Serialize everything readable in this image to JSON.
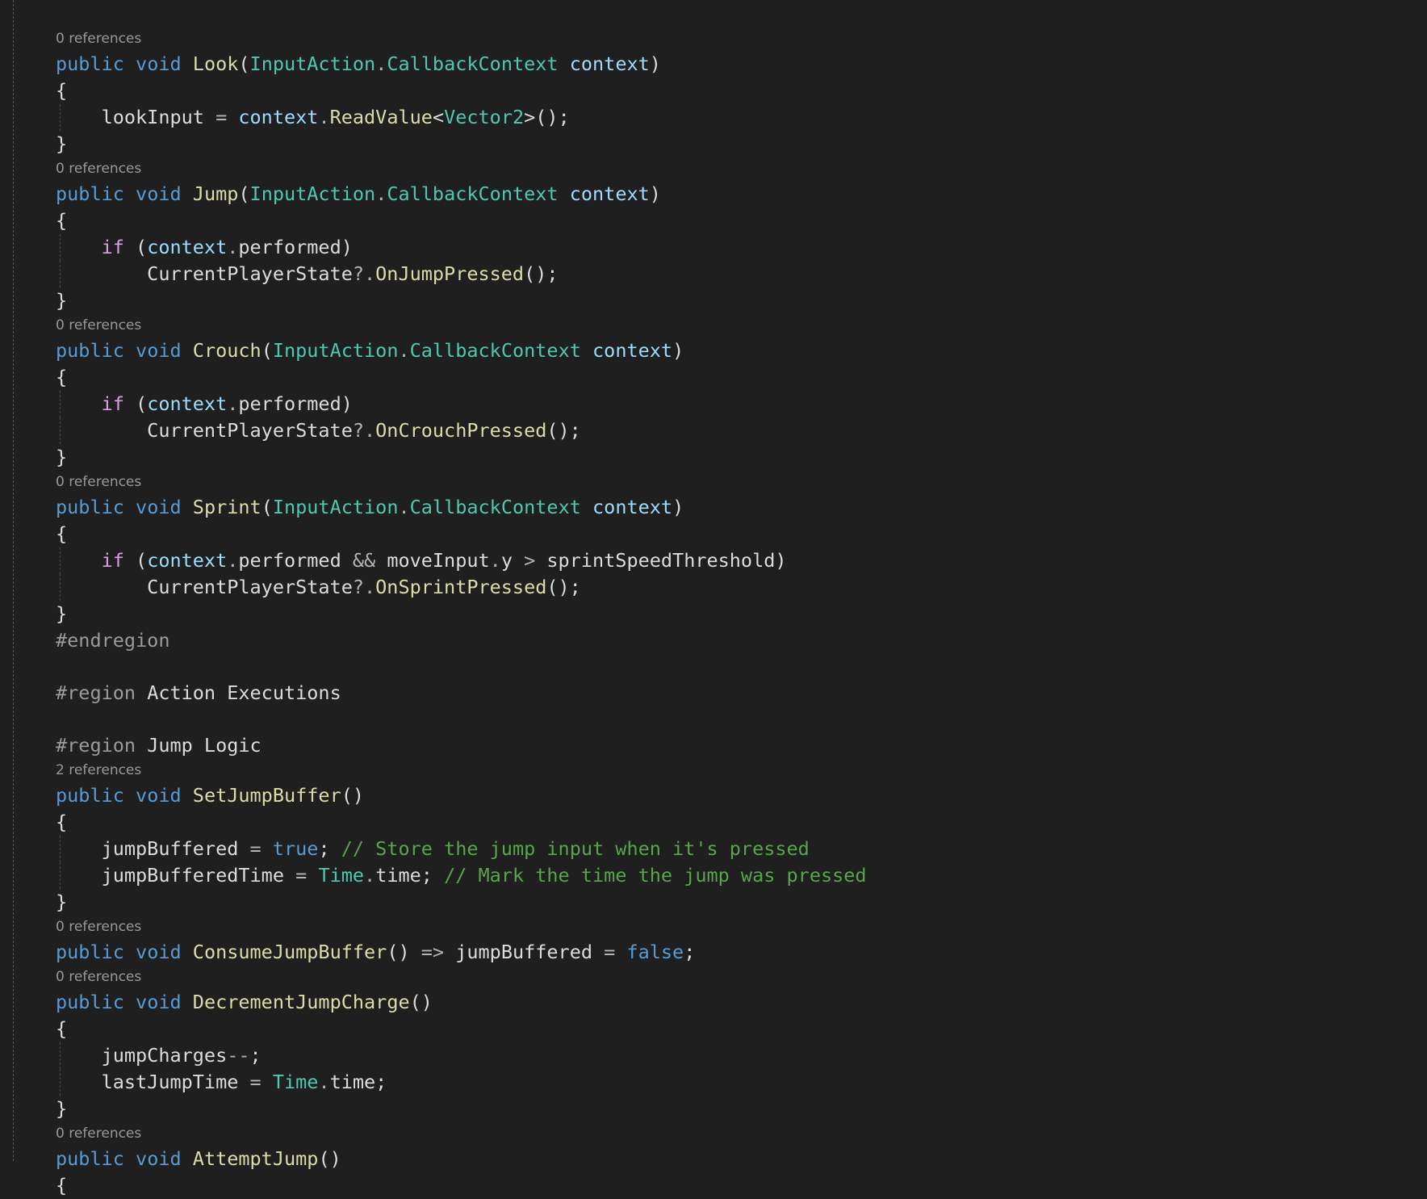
{
  "editor": {
    "colors": {
      "background": "#1f1f1f",
      "keyword": "#569cd6",
      "type": "#4ec9b0",
      "method": "#dcdcaa",
      "variable": "#9cdcfe",
      "control": "#d8a0df",
      "comment": "#57a64a",
      "preprocessor": "#9b9b9b",
      "codelens": "#999999"
    },
    "lines": [
      {
        "kind": "ref",
        "text": "0 references"
      },
      {
        "kind": "code",
        "t": [
          [
            "k",
            "public"
          ],
          [
            "p",
            " "
          ],
          [
            "k",
            "void"
          ],
          [
            "p",
            " "
          ],
          [
            "f",
            "Look"
          ],
          [
            "p",
            "("
          ],
          [
            "t",
            "InputAction"
          ],
          [
            "o",
            "."
          ],
          [
            "t",
            "CallbackContext"
          ],
          [
            "p",
            " "
          ],
          [
            "v",
            "context"
          ],
          [
            "p",
            ")"
          ]
        ]
      },
      {
        "kind": "code",
        "t": [
          [
            "p",
            "{"
          ]
        ]
      },
      {
        "kind": "code",
        "g": 1,
        "t": [
          [
            "p",
            "    lookInput "
          ],
          [
            "o",
            "="
          ],
          [
            "p",
            " "
          ],
          [
            "v",
            "context"
          ],
          [
            "o",
            "."
          ],
          [
            "f",
            "ReadValue"
          ],
          [
            "p",
            "<"
          ],
          [
            "t",
            "Vector2"
          ],
          [
            "p",
            ">();"
          ]
        ]
      },
      {
        "kind": "code",
        "t": [
          [
            "p",
            "}"
          ]
        ]
      },
      {
        "kind": "ref",
        "text": "0 references"
      },
      {
        "kind": "code",
        "t": [
          [
            "k",
            "public"
          ],
          [
            "p",
            " "
          ],
          [
            "k",
            "void"
          ],
          [
            "p",
            " "
          ],
          [
            "f",
            "Jump"
          ],
          [
            "p",
            "("
          ],
          [
            "t",
            "InputAction"
          ],
          [
            "o",
            "."
          ],
          [
            "t",
            "CallbackContext"
          ],
          [
            "p",
            " "
          ],
          [
            "v",
            "context"
          ],
          [
            "p",
            ")"
          ]
        ]
      },
      {
        "kind": "code",
        "t": [
          [
            "p",
            "{"
          ]
        ]
      },
      {
        "kind": "code",
        "g": 1,
        "t": [
          [
            "p",
            "    "
          ],
          [
            "x",
            "if"
          ],
          [
            "p",
            " ("
          ],
          [
            "v",
            "context"
          ],
          [
            "o",
            "."
          ],
          [
            "p",
            "performed)"
          ]
        ]
      },
      {
        "kind": "code",
        "g": 1,
        "t": [
          [
            "p",
            "        CurrentPlayerState"
          ],
          [
            "o",
            "?."
          ],
          [
            "f",
            "OnJumpPressed"
          ],
          [
            "p",
            "();"
          ]
        ]
      },
      {
        "kind": "code",
        "t": [
          [
            "p",
            "}"
          ]
        ]
      },
      {
        "kind": "ref",
        "text": "0 references"
      },
      {
        "kind": "code",
        "t": [
          [
            "k",
            "public"
          ],
          [
            "p",
            " "
          ],
          [
            "k",
            "void"
          ],
          [
            "p",
            " "
          ],
          [
            "f",
            "Crouch"
          ],
          [
            "p",
            "("
          ],
          [
            "t",
            "InputAction"
          ],
          [
            "o",
            "."
          ],
          [
            "t",
            "CallbackContext"
          ],
          [
            "p",
            " "
          ],
          [
            "v",
            "context"
          ],
          [
            "p",
            ")"
          ]
        ]
      },
      {
        "kind": "code",
        "t": [
          [
            "p",
            "{"
          ]
        ]
      },
      {
        "kind": "code",
        "g": 1,
        "t": [
          [
            "p",
            "    "
          ],
          [
            "x",
            "if"
          ],
          [
            "p",
            " ("
          ],
          [
            "v",
            "context"
          ],
          [
            "o",
            "."
          ],
          [
            "p",
            "performed)"
          ]
        ]
      },
      {
        "kind": "code",
        "g": 1,
        "t": [
          [
            "p",
            "        CurrentPlayerState"
          ],
          [
            "o",
            "?."
          ],
          [
            "f",
            "OnCrouchPressed"
          ],
          [
            "p",
            "();"
          ]
        ]
      },
      {
        "kind": "code",
        "t": [
          [
            "p",
            "}"
          ]
        ]
      },
      {
        "kind": "ref",
        "text": "0 references"
      },
      {
        "kind": "code",
        "t": [
          [
            "k",
            "public"
          ],
          [
            "p",
            " "
          ],
          [
            "k",
            "void"
          ],
          [
            "p",
            " "
          ],
          [
            "f",
            "Sprint"
          ],
          [
            "p",
            "("
          ],
          [
            "t",
            "InputAction"
          ],
          [
            "o",
            "."
          ],
          [
            "t",
            "CallbackContext"
          ],
          [
            "p",
            " "
          ],
          [
            "v",
            "context"
          ],
          [
            "p",
            ")"
          ]
        ]
      },
      {
        "kind": "code",
        "t": [
          [
            "p",
            "{"
          ]
        ]
      },
      {
        "kind": "code",
        "g": 1,
        "t": [
          [
            "p",
            "    "
          ],
          [
            "x",
            "if"
          ],
          [
            "p",
            " ("
          ],
          [
            "v",
            "context"
          ],
          [
            "o",
            "."
          ],
          [
            "p",
            "performed "
          ],
          [
            "o",
            "&&"
          ],
          [
            "p",
            " moveInput"
          ],
          [
            "o",
            "."
          ],
          [
            "p",
            "y "
          ],
          [
            "o",
            ">"
          ],
          [
            "p",
            " sprintSpeedThreshold)"
          ]
        ]
      },
      {
        "kind": "code",
        "g": 1,
        "t": [
          [
            "p",
            "        CurrentPlayerState"
          ],
          [
            "o",
            "?."
          ],
          [
            "f",
            "OnSprintPressed"
          ],
          [
            "p",
            "();"
          ]
        ]
      },
      {
        "kind": "code",
        "t": [
          [
            "p",
            "}"
          ]
        ]
      },
      {
        "kind": "code",
        "t": [
          [
            "r",
            "#endregion"
          ]
        ]
      },
      {
        "kind": "blank"
      },
      {
        "kind": "code",
        "t": [
          [
            "r",
            "#region"
          ],
          [
            "p",
            " Action Executions"
          ]
        ]
      },
      {
        "kind": "blank"
      },
      {
        "kind": "code",
        "t": [
          [
            "r",
            "#region"
          ],
          [
            "p",
            " Jump Logic"
          ]
        ]
      },
      {
        "kind": "ref",
        "text": "2 references"
      },
      {
        "kind": "code",
        "t": [
          [
            "k",
            "public"
          ],
          [
            "p",
            " "
          ],
          [
            "k",
            "void"
          ],
          [
            "p",
            " "
          ],
          [
            "f",
            "SetJumpBuffer"
          ],
          [
            "p",
            "()"
          ]
        ]
      },
      {
        "kind": "code",
        "t": [
          [
            "p",
            "{"
          ]
        ]
      },
      {
        "kind": "code",
        "g": 1,
        "t": [
          [
            "p",
            "    jumpBuffered "
          ],
          [
            "o",
            "="
          ],
          [
            "p",
            " "
          ],
          [
            "k",
            "true"
          ],
          [
            "p",
            "; "
          ],
          [
            "m",
            "// Store the jump input when it's pressed"
          ]
        ]
      },
      {
        "kind": "code",
        "g": 1,
        "t": [
          [
            "p",
            "    jumpBufferedTime "
          ],
          [
            "o",
            "="
          ],
          [
            "p",
            " "
          ],
          [
            "t",
            "Time"
          ],
          [
            "o",
            "."
          ],
          [
            "p",
            "time; "
          ],
          [
            "m",
            "// Mark the time the jump was pressed"
          ]
        ]
      },
      {
        "kind": "code",
        "t": [
          [
            "p",
            "}"
          ]
        ]
      },
      {
        "kind": "ref",
        "text": "0 references"
      },
      {
        "kind": "code",
        "t": [
          [
            "k",
            "public"
          ],
          [
            "p",
            " "
          ],
          [
            "k",
            "void"
          ],
          [
            "p",
            " "
          ],
          [
            "f",
            "ConsumeJumpBuffer"
          ],
          [
            "p",
            "() "
          ],
          [
            "o",
            "=>"
          ],
          [
            "p",
            " jumpBuffered "
          ],
          [
            "o",
            "="
          ],
          [
            "p",
            " "
          ],
          [
            "k",
            "false"
          ],
          [
            "p",
            ";"
          ]
        ]
      },
      {
        "kind": "ref",
        "text": "0 references"
      },
      {
        "kind": "code",
        "t": [
          [
            "k",
            "public"
          ],
          [
            "p",
            " "
          ],
          [
            "k",
            "void"
          ],
          [
            "p",
            " "
          ],
          [
            "f",
            "DecrementJumpCharge"
          ],
          [
            "p",
            "()"
          ]
        ]
      },
      {
        "kind": "code",
        "t": [
          [
            "p",
            "{"
          ]
        ]
      },
      {
        "kind": "code",
        "g": 1,
        "t": [
          [
            "p",
            "    jumpCharges"
          ],
          [
            "o",
            "--"
          ],
          [
            "p",
            ";"
          ]
        ]
      },
      {
        "kind": "code",
        "g": 1,
        "t": [
          [
            "p",
            "    lastJumpTime "
          ],
          [
            "o",
            "="
          ],
          [
            "p",
            " "
          ],
          [
            "t",
            "Time"
          ],
          [
            "o",
            "."
          ],
          [
            "p",
            "time;"
          ]
        ]
      },
      {
        "kind": "code",
        "t": [
          [
            "p",
            "}"
          ]
        ]
      },
      {
        "kind": "ref",
        "text": "0 references"
      },
      {
        "kind": "code",
        "t": [
          [
            "k",
            "public"
          ],
          [
            "p",
            " "
          ],
          [
            "k",
            "void"
          ],
          [
            "p",
            " "
          ],
          [
            "f",
            "AttemptJump"
          ],
          [
            "p",
            "()"
          ]
        ]
      },
      {
        "kind": "code",
        "t": [
          [
            "p",
            "{"
          ]
        ]
      }
    ]
  }
}
